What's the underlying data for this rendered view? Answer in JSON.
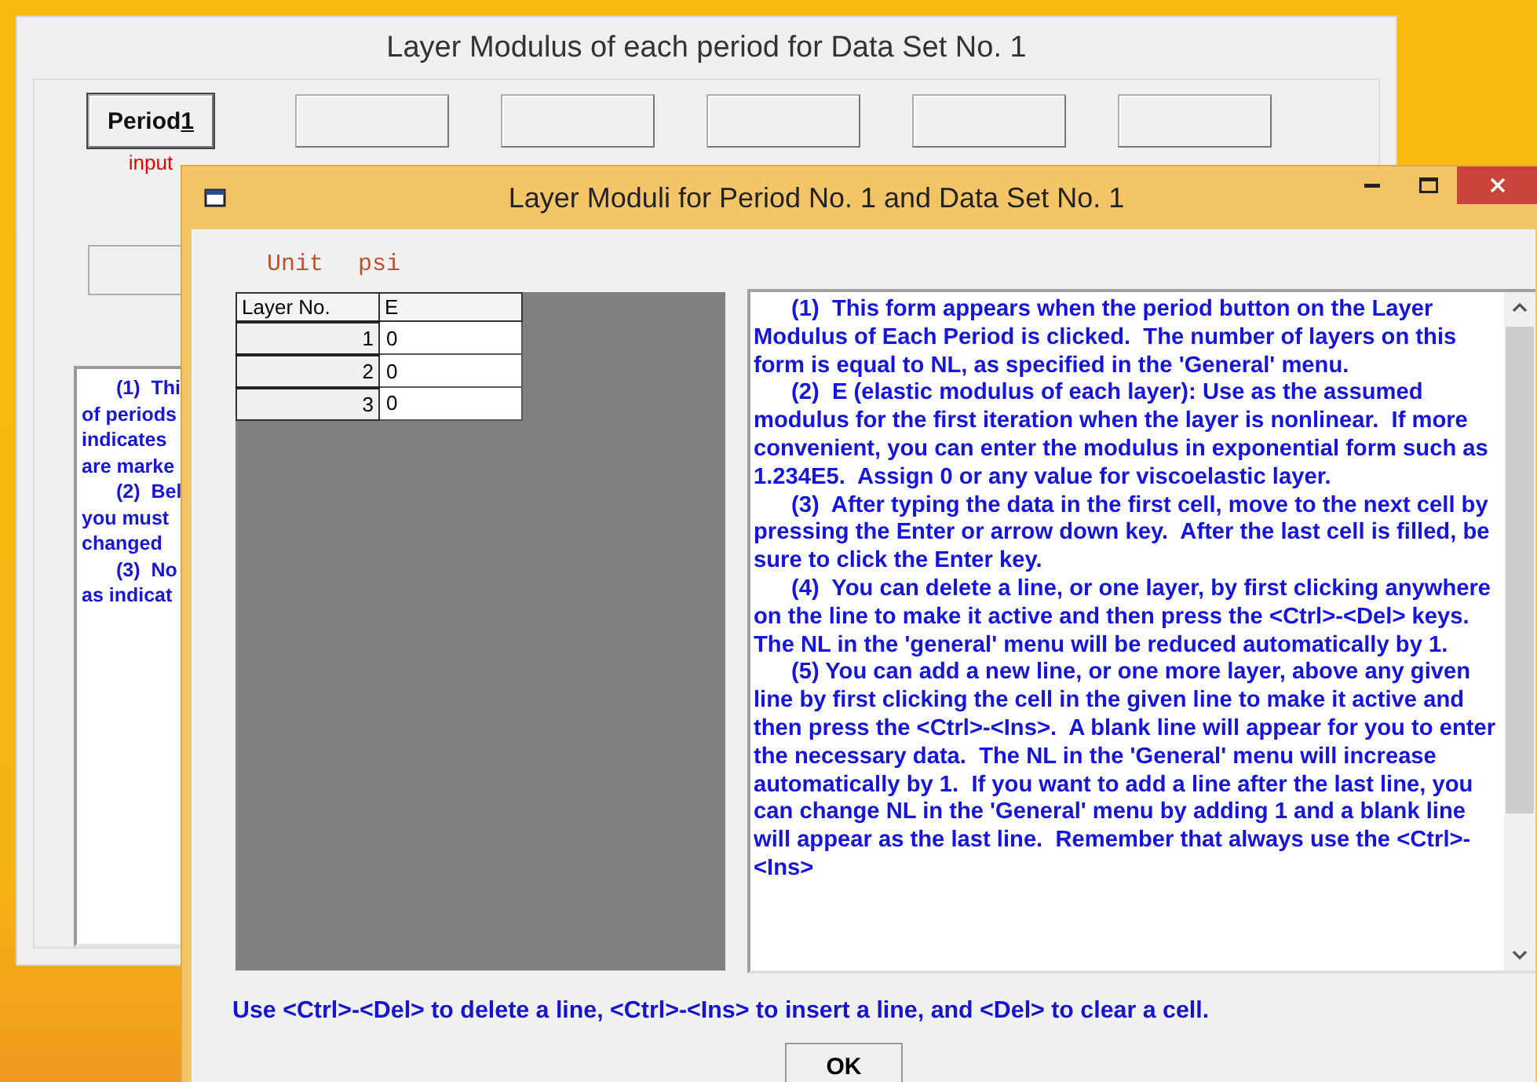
{
  "main_window": {
    "title": "Layer Modulus of each period for Data Set No.  1",
    "period_buttons": [
      {
        "kind": "labeled",
        "label": "Period",
        "access_key": "1",
        "note": "input"
      },
      {
        "kind": "blank"
      },
      {
        "kind": "blank"
      },
      {
        "kind": "blank"
      },
      {
        "kind": "blank"
      },
      {
        "kind": "blank"
      }
    ],
    "help_lines": [
      {
        "text": "(1)  Thi",
        "indent": true
      },
      {
        "text": "of periods",
        "indent": false
      },
      {
        "text": "indicates",
        "indent": false
      },
      {
        "text": "are marke",
        "indent": false
      },
      {
        "text": "(2)  Bel",
        "indent": true
      },
      {
        "text": "you must",
        "indent": false
      },
      {
        "text": "changed",
        "indent": false
      },
      {
        "text": "(3)  No",
        "indent": true
      },
      {
        "text": "as indicat",
        "indent": false
      }
    ]
  },
  "dialog": {
    "title": "Layer Moduli for Period No. 1 and Data Set No. 1",
    "unit_label": "Unit",
    "unit_value": "psi",
    "table": {
      "columns": [
        "Layer No.",
        "E"
      ],
      "rows": [
        {
          "layer": "1",
          "e": "0"
        },
        {
          "layer": "2",
          "e": "0"
        },
        {
          "layer": "3",
          "e": "0"
        }
      ]
    },
    "help_paragraphs": [
      "(1)  This form appears when the period button on the Layer Modulus of Each Period is clicked.  The number of layers on this form is equal to NL, as specified in the 'General' menu.",
      "(2)  E (elastic modulus of each layer): Use as the assumed modulus for the first iteration when the layer is nonlinear.  If more convenient, you can enter the modulus in exponential form such as 1.234E5.  Assign 0 or any value for viscoelastic layer.",
      "(3)  After typing the data in the first cell, move to the next cell by pressing the Enter or arrow down key.  After the last cell is filled, be sure to click the Enter key.",
      "(4)  You can delete a line, or one layer, by first clicking anywhere on the line to make it active and then press the <Ctrl>-<Del> keys.  The NL in the 'general' menu will be reduced automatically by 1.",
      "(5) You can add a new line, or one more layer, above any given line by first clicking the cell in the given line to make it active and then press the <Ctrl>-<Ins>.  A blank line will appear for you to enter the necessary data.  The NL in the 'General' menu will increase automatically by 1.  If you want to add a line after the last line, you can change NL in the 'General' menu by adding 1 and a blank line will appear as the last line.  Remember that always use the <Ctrl>-<Ins>"
    ],
    "message": "Use <Ctrl>-<Del> to delete a line, <Ctrl>-<Ins> to insert a line, and <Del> to clear a cell.",
    "ok_button": "OK"
  }
}
